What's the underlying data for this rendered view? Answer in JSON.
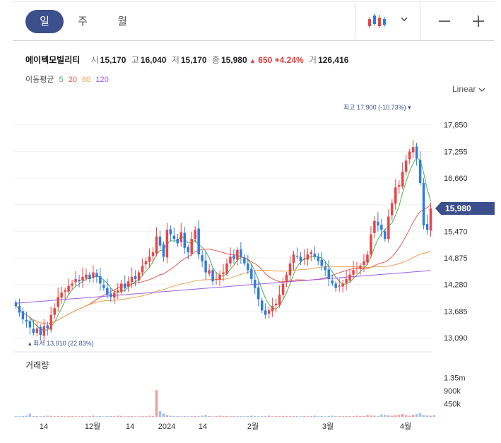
{
  "header": {
    "periods": [
      "일",
      "주",
      "월"
    ],
    "active_period": "일"
  },
  "quote": {
    "name": "에이텍모빌리티",
    "open_label": "시",
    "open": "15,170",
    "high_label": "고",
    "high": "16,040",
    "low_label": "저",
    "low": "15,170",
    "close_label": "종",
    "close": "15,980",
    "change_arrow": "▲",
    "change": "650",
    "change_pct": "+4.24%",
    "volume_label": "거",
    "volume": "126,416"
  },
  "moving_average": {
    "label": "이동평균",
    "periods": [
      {
        "value": "5",
        "color": "#4caf50"
      },
      {
        "value": "20",
        "color": "#e8574f"
      },
      {
        "value": "60",
        "color": "#f0a04b"
      },
      {
        "value": "120",
        "color": "#9b5de5"
      }
    ]
  },
  "scale_label": "Linear",
  "colors": {
    "up": "#e84545",
    "down": "#2f7be0",
    "accent": "#3b4f8c"
  },
  "chart_data": {
    "type": "candlestick",
    "price_axis_ticks": [
      17850,
      17255,
      16660,
      16065,
      15470,
      14875,
      14280,
      13685,
      13090
    ],
    "price_tick_labels": [
      "17,850",
      "17,255",
      "16,660",
      "16,065",
      "15,470",
      "14,875",
      "14,280",
      "13,685",
      "13,090"
    ],
    "ylim": [
      12900,
      18350
    ],
    "last_price_label": "15,980",
    "last_price": 15980,
    "max_annotation": {
      "prefix": "최고",
      "value": "17,900",
      "pct": "(-10.73%)"
    },
    "min_annotation": {
      "prefix": "최저",
      "value": "13,010",
      "pct": "(22.83%)"
    },
    "x_tick_labels": [
      "14",
      "12월",
      "14",
      "2024",
      "14",
      "2월",
      "3월",
      "4월"
    ],
    "volume_panel": {
      "title": "거래량",
      "tick_labels": [
        "1.35m",
        "900k",
        "450k"
      ],
      "ticks": [
        1350000,
        900000,
        450000
      ],
      "ylim": [
        0,
        1700000
      ]
    },
    "ohlc_anchor": {
      "note_dates": "approx mid-Nov 2023 to mid-Apr 2024",
      "closes": [
        13800,
        13650,
        13500,
        13450,
        13320,
        13200,
        13300,
        13150,
        13350,
        13300,
        13600,
        13750,
        14000,
        14100,
        14150,
        14250,
        14300,
        14400,
        14350,
        14450,
        14500,
        14400,
        14550,
        14450,
        14300,
        14200,
        14050,
        14000,
        14100,
        14150,
        14300,
        14200,
        14350,
        14450,
        14400,
        14550,
        14700,
        14800,
        14900,
        15000,
        15350,
        15150,
        14900,
        15500,
        15400,
        15300,
        15200,
        15450,
        15100,
        15000,
        15300,
        15500,
        14950,
        14800,
        14550,
        14600,
        14350,
        14400,
        14500,
        14550,
        14750,
        14900,
        14850,
        15050,
        14900,
        14750,
        14600,
        14400,
        14200,
        13950,
        13700,
        13600,
        13700,
        13800,
        13850,
        14050,
        14300,
        14500,
        14750,
        14950,
        14900,
        14800,
        14850,
        14950,
        15000,
        14900,
        14800,
        14700,
        14600,
        14400,
        14300,
        14200,
        14250,
        14300,
        14400,
        14500,
        14600,
        14650,
        14700,
        14800,
        14950,
        15400,
        15700,
        15600,
        15500,
        15300,
        15800,
        16100,
        16450,
        16500,
        16800,
        17050,
        17250,
        17350,
        17100,
        16550,
        15600,
        15500,
        15980
      ],
      "volume_bars_thousands": [
        30,
        20,
        25,
        40,
        110,
        30,
        25,
        20,
        30,
        40,
        30,
        20,
        25,
        30,
        20,
        25,
        30,
        20,
        20,
        25,
        20,
        30,
        40,
        20,
        25,
        20,
        30,
        25,
        20,
        40,
        30,
        20,
        25,
        30,
        20,
        20,
        30,
        20,
        40,
        25,
        920,
        200,
        120,
        60,
        40,
        30,
        25,
        20,
        30,
        20,
        25,
        30,
        20,
        40,
        60,
        30,
        20,
        25,
        40,
        30,
        30,
        20,
        25,
        20,
        30,
        20,
        25,
        40,
        30,
        20,
        25,
        30,
        40,
        20,
        30,
        25,
        20,
        30,
        20,
        25,
        30,
        20,
        25,
        20,
        30,
        40,
        20,
        25,
        20,
        30,
        40,
        25,
        30,
        20,
        25,
        30,
        20,
        40,
        30,
        25,
        60,
        50,
        40,
        30,
        80,
        70,
        50,
        40,
        60,
        70,
        100,
        60,
        40,
        70,
        90,
        120,
        60,
        50,
        40,
        60
      ]
    }
  }
}
